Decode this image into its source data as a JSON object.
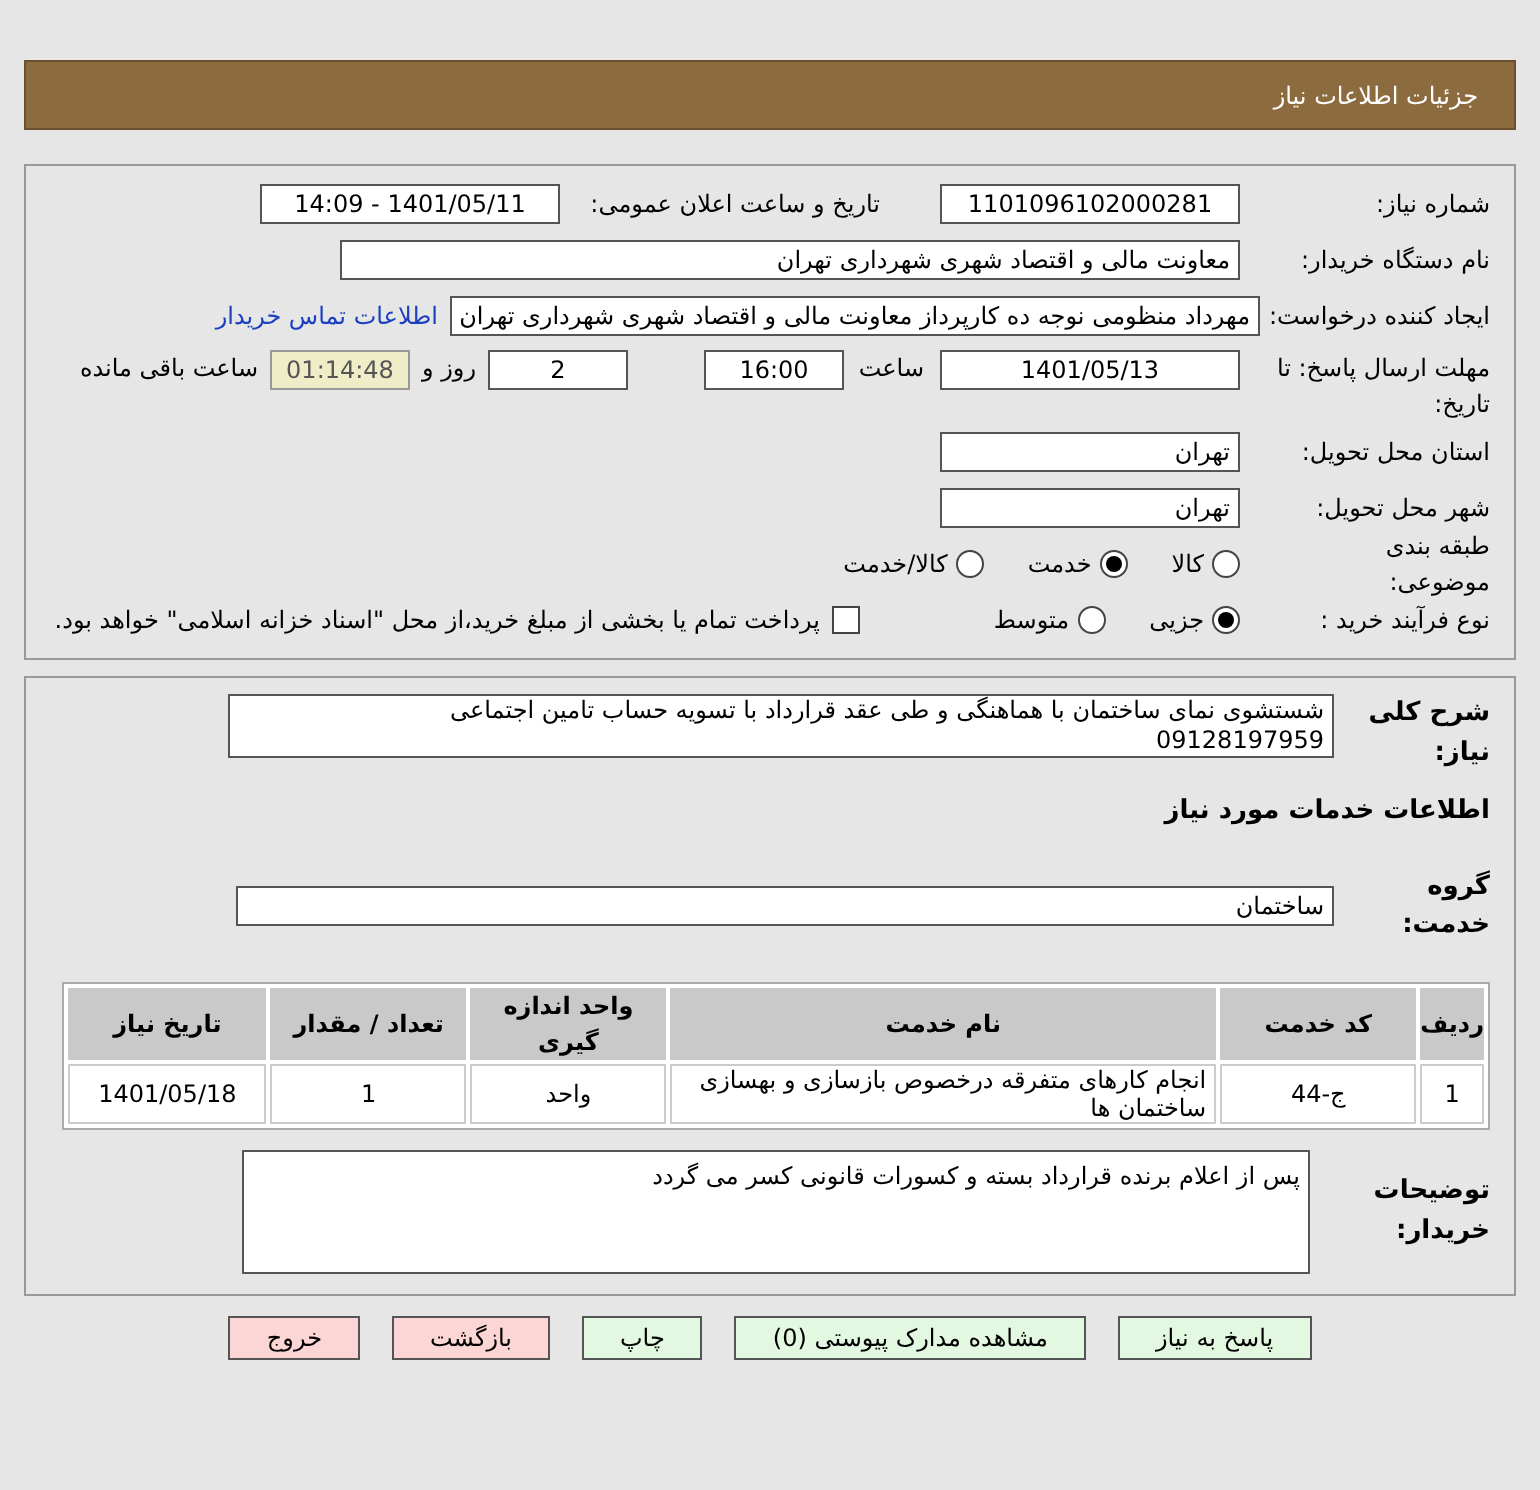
{
  "header": {
    "title": "جزئیات اطلاعات نیاز"
  },
  "need_number": {
    "label": "شماره نیاز:",
    "value": "1101096102000281"
  },
  "announce": {
    "label": "تاریخ و ساعت اعلان عمومی:",
    "value": "1401/05/11 - 14:09"
  },
  "buyer_org": {
    "label": "نام دستگاه خریدار:",
    "value": "معاونت مالی و اقتصاد شهری شهرداری تهران"
  },
  "requester": {
    "label": "ایجاد کننده درخواست:",
    "value": "مهرداد منظومی نوجه ده کارپرداز معاونت مالی و اقتصاد شهری شهرداری تهران",
    "link": "اطلاعات تماس خریدار"
  },
  "deadline": {
    "label": "مهلت ارسال پاسخ: تا تاریخ:",
    "date": "1401/05/13",
    "time_label": "ساعت",
    "time": "16:00",
    "days": "2",
    "days_label": "روز و",
    "remaining": "01:14:48",
    "remaining_label": "ساعت باقی مانده"
  },
  "province": {
    "label": "استان محل تحویل:",
    "value": "تهران"
  },
  "city": {
    "label": "شهر محل تحویل:",
    "value": "تهران"
  },
  "category": {
    "label": "طبقه بندی موضوعی:",
    "options": [
      {
        "label": "کالا",
        "selected": false
      },
      {
        "label": "خدمت",
        "selected": true
      },
      {
        "label": "کالا/خدمت",
        "selected": false
      }
    ]
  },
  "process": {
    "label": "نوع فرآیند خرید :",
    "options": [
      {
        "label": "جزیی",
        "selected": true
      },
      {
        "label": "متوسط",
        "selected": false
      }
    ],
    "treasury": {
      "checked": false,
      "label": "پرداخت تمام یا بخشی از مبلغ خرید،از محل \"اسناد خزانه اسلامی\" خواهد بود."
    }
  },
  "description": {
    "label": "شرح کلی نیاز:",
    "lines": [
      "شستشوی نمای ساختمان با هماهنگی و طی عقد قرارداد با تسویه حساب تامین اجتماعی",
      "09128197959"
    ]
  },
  "services_heading": "اطلاعات خدمات مورد نیاز",
  "service_group": {
    "label": "گروه خدمت:",
    "value": "ساختمان"
  },
  "table": {
    "columns": [
      "ردیف",
      "کد خدمت",
      "نام خدمت",
      "واحد اندازه گیری",
      "تعداد / مقدار",
      "تاریخ نیاز"
    ],
    "rows": [
      [
        "1",
        "ج-44",
        "انجام کارهای متفرقه درخصوص بازسازی و بهسازی ساختمان ها",
        "واحد",
        "1",
        "1401/05/18"
      ]
    ]
  },
  "notes": {
    "label": "توضیحات خریدار:",
    "value": "پس از اعلام برنده قرارداد بسته و کسورات قانونی کسر می گردد"
  },
  "buttons": [
    {
      "label": "پاسخ به نیاز",
      "kind": "normal"
    },
    {
      "label": "مشاهده مدارک پیوستی (0)",
      "kind": "normal"
    },
    {
      "label": "چاپ",
      "kind": "normal"
    },
    {
      "label": "بازگشت",
      "kind": "exit"
    },
    {
      "label": "خروج",
      "kind": "exit"
    }
  ]
}
